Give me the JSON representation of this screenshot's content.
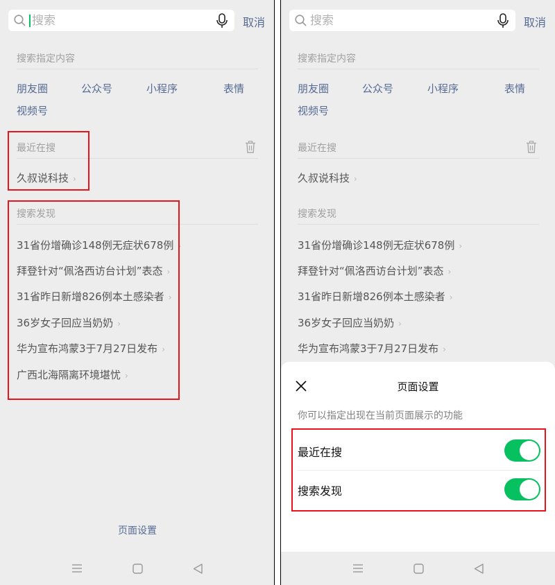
{
  "search": {
    "placeholder": "搜索",
    "cancel_label": "取消"
  },
  "specified_content": {
    "title": "搜索指定内容",
    "categories": [
      "朋友圈",
      "公众号",
      "小程序",
      "表情",
      "视频号"
    ]
  },
  "recent": {
    "title": "最近在搜",
    "items": [
      "久叔说科技"
    ]
  },
  "discover": {
    "title": "搜索发现",
    "items": [
      "31省份增确诊148例无症状678例",
      "拜登针对“佩洛西访台计划”表态",
      "31省昨日新增826例本土感染者",
      "36岁女子回应当奶奶",
      "华为宣布鸿蒙3于7月27日发布",
      "广西北海隔离环境堪忧"
    ]
  },
  "page_settings_link": "页面设置",
  "sheet": {
    "title": "页面设置",
    "description": "你可以指定出现在当前页面展示的功能",
    "rows": [
      {
        "label": "最近在搜",
        "enabled": true
      },
      {
        "label": "搜索发现",
        "enabled": true
      }
    ]
  },
  "icons": {
    "search": "search-icon",
    "mic": "microphone-icon",
    "trash": "trash-icon",
    "close": "close-icon",
    "nav": [
      "menu-icon",
      "home-square-icon",
      "back-triangle-icon"
    ]
  },
  "colors": {
    "accent_link": "#576b95",
    "toggle_on": "#07c160",
    "highlight_box": "#e8141a",
    "panel_bg": "#ededed"
  }
}
